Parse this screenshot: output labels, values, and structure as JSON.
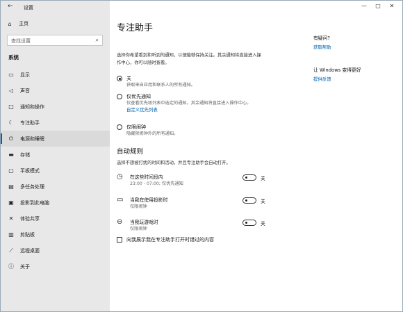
{
  "window": {
    "app_title": "设置",
    "back_icon": "back-arrow-icon",
    "controls": [
      "—",
      "□",
      "✕"
    ]
  },
  "sidebar": {
    "home_label": "主页",
    "search_placeholder": "查找设置",
    "section_label": "系统",
    "items": [
      {
        "label": "显示",
        "icon": "monitor-icon"
      },
      {
        "label": "声音",
        "icon": "speaker-icon"
      },
      {
        "label": "通知和操作",
        "icon": "notification-icon"
      },
      {
        "label": "专注助手",
        "icon": "moon-icon"
      },
      {
        "label": "电源和睡眠",
        "icon": "power-icon",
        "active": true
      },
      {
        "label": "存储",
        "icon": "storage-icon"
      },
      {
        "label": "平板模式",
        "icon": "tablet-icon"
      },
      {
        "label": "多任务处理",
        "icon": "multitask-icon"
      },
      {
        "label": "投影到此电脑",
        "icon": "project-icon"
      },
      {
        "label": "体验共享",
        "icon": "share-icon"
      },
      {
        "label": "剪贴板",
        "icon": "clipboard-icon"
      },
      {
        "label": "远程桌面",
        "icon": "remote-icon"
      },
      {
        "label": "关于",
        "icon": "info-icon"
      }
    ]
  },
  "main": {
    "title": "专注助手",
    "description": "选择你希望看到和听到的通知，以便能够保持关注。其余通知将直接进入操作中心，你可以随时查看。",
    "radios": [
      {
        "label": "关",
        "sub": "获取来自应用和联系人的所有通知。",
        "checked": true
      },
      {
        "label": "仅优先通知",
        "sub": "仅查看优先级列表中选定的通知。其余通知将直接进入操作中心。",
        "link": "自定义优先列表"
      },
      {
        "label": "仅限闹钟",
        "sub": "隐藏除闹钟外的所有通知。"
      }
    ],
    "auto_title": "自动规则",
    "auto_desc": "选择不想被打扰的时间和活动，并且专注助手会自动打开。",
    "rules": [
      {
        "title": "在这些时间段内",
        "sub": "23:00 - 07:00; 仅优先通知",
        "state": "关",
        "icon": "clock-icon"
      },
      {
        "title": "当我在使用投影时",
        "sub": "仅限闹钟",
        "state": "关",
        "icon": "display-icon"
      },
      {
        "title": "当我玩游戏时",
        "sub": "仅限闹钟",
        "state": "关",
        "icon": "gamepad-icon"
      }
    ],
    "checkbox_label": "向我展示我在专注助手打开时错过的内容"
  },
  "right": {
    "question_title": "有疑问?",
    "help_link": "获取帮助",
    "feedback_title": "让 Windows 变得更好",
    "feedback_link": "提供反馈"
  }
}
